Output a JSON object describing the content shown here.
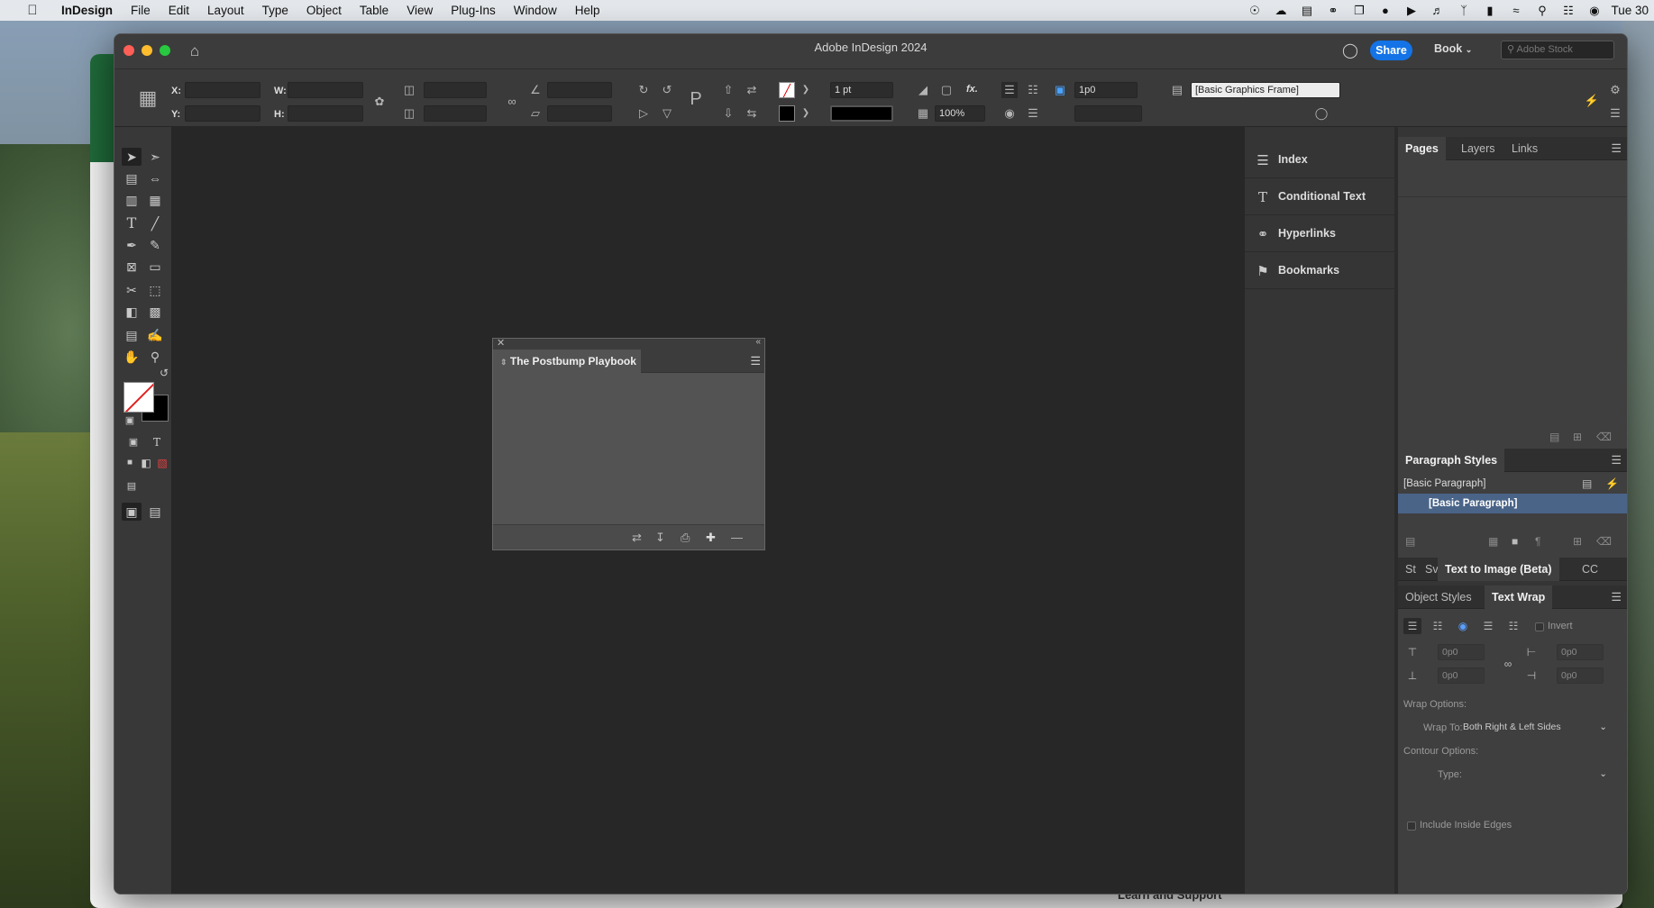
{
  "menubar": {
    "app_name": "InDesign",
    "items": [
      "File",
      "Edit",
      "Layout",
      "Type",
      "Object",
      "Table",
      "View",
      "Plug-Ins",
      "Window",
      "Help"
    ],
    "clock": "Tue 30"
  },
  "window": {
    "title": "Adobe InDesign 2024",
    "share_label": "Share",
    "book_label": "Book",
    "stock_placeholder": "Adobe Stock"
  },
  "controlbar": {
    "x_label": "X:",
    "y_label": "Y:",
    "w_label": "W:",
    "h_label": "H:",
    "stroke_weight": "1 pt",
    "offset_value": "1p0",
    "opacity": "100%",
    "object_style": "[Basic Graphics Frame]",
    "fx_label": "fx."
  },
  "book_panel": {
    "title": "The Postbump Playbook"
  },
  "dock_mid": {
    "items": [
      {
        "label": "Index",
        "icon": "index-icon"
      },
      {
        "label": "Conditional Text",
        "icon": "conditional-text-icon"
      },
      {
        "label": "Hyperlinks",
        "icon": "hyperlinks-icon"
      },
      {
        "label": "Bookmarks",
        "icon": "bookmarks-icon"
      }
    ]
  },
  "pages_panel": {
    "tabs": [
      "Pages",
      "Layers",
      "Links"
    ]
  },
  "paragraph_styles": {
    "tab": "Paragraph Styles",
    "current": "[Basic Paragraph]",
    "rows": [
      "[Basic Paragraph]"
    ]
  },
  "text_to_image": {
    "tabs": [
      "St",
      "Sv",
      "Text to Image (Beta)",
      "CC"
    ]
  },
  "text_wrap": {
    "tabs": [
      "Object Styles",
      "Text Wrap"
    ],
    "invert_label": "Invert",
    "top_offset": "0p0",
    "bottom_offset": "0p0",
    "left_offset": "0p0",
    "right_offset": "0p0",
    "wrap_options_label": "Wrap Options:",
    "wrap_to_label": "Wrap To:",
    "wrap_to_value": "Both Right & Left Sides",
    "contour_options_label": "Contour Options:",
    "type_label": "Type:",
    "include_inside_edges_label": "Include Inside Edges"
  },
  "behind": {
    "bottom_text": "Learn and Support"
  }
}
